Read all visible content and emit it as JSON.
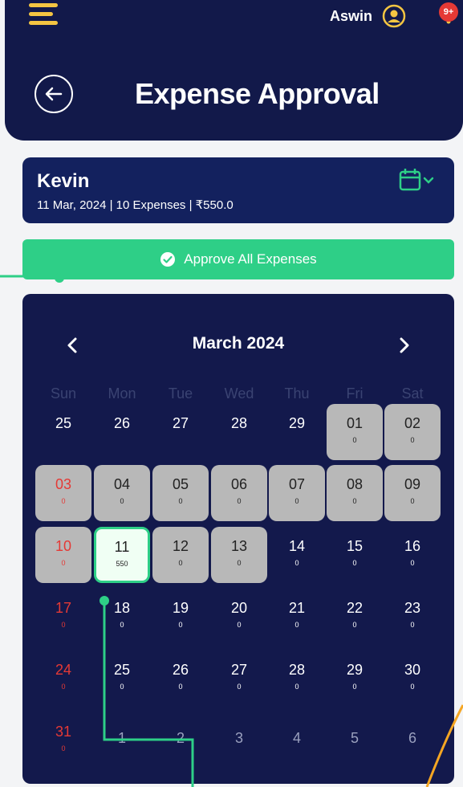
{
  "header": {
    "username": "Aswin",
    "title": "Expense Approval",
    "notification_badge": "9+"
  },
  "summary": {
    "name": "Kevin",
    "meta": "11 Mar, 2024  | 10 Expenses | ₹550.0"
  },
  "approve_button": {
    "label": "Approve All Expenses"
  },
  "calendar": {
    "month_label": "March 2024",
    "weekdays": [
      "Sun",
      "Mon",
      "Tue",
      "Wed",
      "Thu",
      "Fri",
      "Sat"
    ],
    "weeks": [
      [
        {
          "day": "25",
          "count": "",
          "style": "plain"
        },
        {
          "day": "26",
          "count": "",
          "style": "plain"
        },
        {
          "day": "27",
          "count": "",
          "style": "plain"
        },
        {
          "day": "28",
          "count": "",
          "style": "plain"
        },
        {
          "day": "29",
          "count": "",
          "style": "plain"
        },
        {
          "day": "01",
          "count": "0",
          "style": "active"
        },
        {
          "day": "02",
          "count": "0",
          "style": "active"
        }
      ],
      [
        {
          "day": "03",
          "count": "0",
          "style": "active-sun"
        },
        {
          "day": "04",
          "count": "0",
          "style": "active"
        },
        {
          "day": "05",
          "count": "0",
          "style": "active"
        },
        {
          "day": "06",
          "count": "0",
          "style": "active"
        },
        {
          "day": "07",
          "count": "0",
          "style": "active"
        },
        {
          "day": "08",
          "count": "0",
          "style": "active"
        },
        {
          "day": "09",
          "count": "0",
          "style": "active"
        }
      ],
      [
        {
          "day": "10",
          "count": "0",
          "style": "active-sun"
        },
        {
          "day": "11",
          "count": "550",
          "style": "selected"
        },
        {
          "day": "12",
          "count": "0",
          "style": "active"
        },
        {
          "day": "13",
          "count": "0",
          "style": "active"
        },
        {
          "day": "14",
          "count": "0",
          "style": "plain"
        },
        {
          "day": "15",
          "count": "0",
          "style": "plain"
        },
        {
          "day": "16",
          "count": "0",
          "style": "plain"
        }
      ],
      [
        {
          "day": "17",
          "count": "0",
          "style": "sun"
        },
        {
          "day": "18",
          "count": "0",
          "style": "plain"
        },
        {
          "day": "19",
          "count": "0",
          "style": "plain"
        },
        {
          "day": "20",
          "count": "0",
          "style": "plain"
        },
        {
          "day": "21",
          "count": "0",
          "style": "plain"
        },
        {
          "day": "22",
          "count": "0",
          "style": "plain"
        },
        {
          "day": "23",
          "count": "0",
          "style": "plain"
        }
      ],
      [
        {
          "day": "24",
          "count": "0",
          "style": "sun"
        },
        {
          "day": "25",
          "count": "0",
          "style": "plain"
        },
        {
          "day": "26",
          "count": "0",
          "style": "plain"
        },
        {
          "day": "27",
          "count": "0",
          "style": "plain"
        },
        {
          "day": "28",
          "count": "0",
          "style": "plain"
        },
        {
          "day": "29",
          "count": "0",
          "style": "plain"
        },
        {
          "day": "30",
          "count": "0",
          "style": "plain"
        }
      ],
      [
        {
          "day": "31",
          "count": "0",
          "style": "sun"
        },
        {
          "day": "1",
          "count": "",
          "style": "faded"
        },
        {
          "day": "2",
          "count": "",
          "style": "faded"
        },
        {
          "day": "3",
          "count": "",
          "style": "faded"
        },
        {
          "day": "4",
          "count": "",
          "style": "faded"
        },
        {
          "day": "5",
          "count": "",
          "style": "faded"
        },
        {
          "day": "6",
          "count": "",
          "style": "faded"
        }
      ]
    ]
  },
  "colors": {
    "navy": "#12194a",
    "accent_green": "#2ecf87",
    "hamburger_yellow": "#f4c542",
    "sunday_red": "#e53935",
    "active_gray": "#b8b8b8"
  }
}
